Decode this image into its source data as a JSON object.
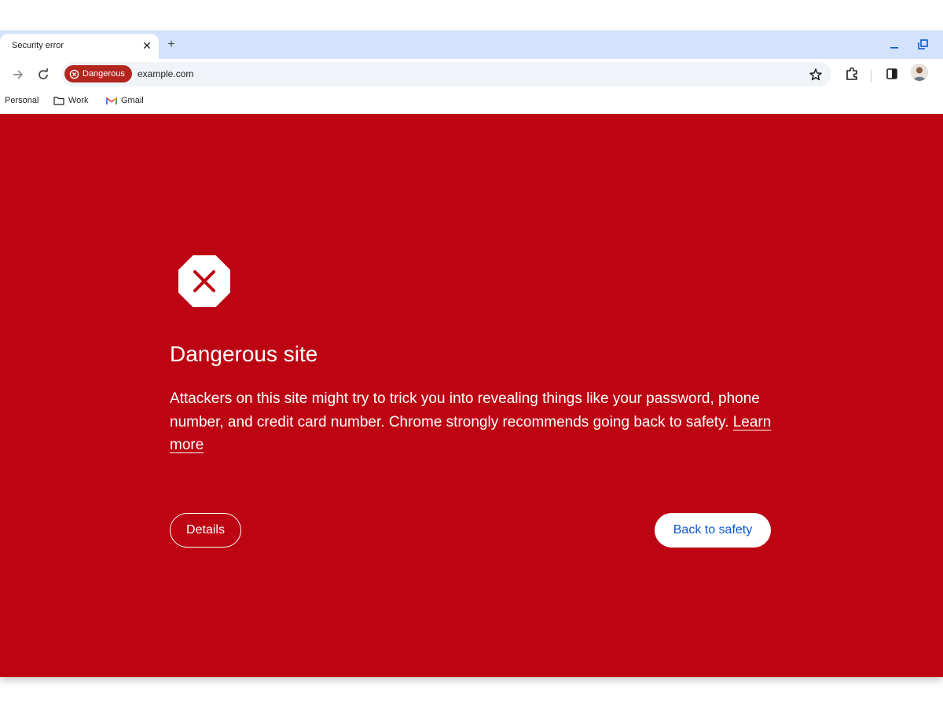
{
  "tab": {
    "title": "Security error",
    "close_glyph": "✕",
    "new_tab_glyph": "+"
  },
  "toolbar": {
    "security_chip": {
      "label": "Dangerous",
      "icon": "danger-circle-icon",
      "color": "#b3261e"
    },
    "url": "example.com",
    "icons": [
      "back-arrow-icon",
      "reload-icon",
      "bookmark-star-icon",
      "extensions-icon",
      "side-panel-icon",
      "profile-avatar"
    ]
  },
  "bookmarks": [
    {
      "label": "Personal",
      "icon": ""
    },
    {
      "label": "Work",
      "icon": "folder-icon"
    },
    {
      "label": "Gmail",
      "icon": "gmail-icon"
    }
  ],
  "interstitial": {
    "background": "#bc0412",
    "icon": "danger-octagon-icon",
    "heading": "Dangerous site",
    "body": "Attackers on this site might try to trick you into revealing things like your password, phone number, and credit card number. Chrome strongly recommends going back to safety.",
    "learn_more": "Learn more",
    "details_button": "Details",
    "back_button": "Back to safety"
  }
}
